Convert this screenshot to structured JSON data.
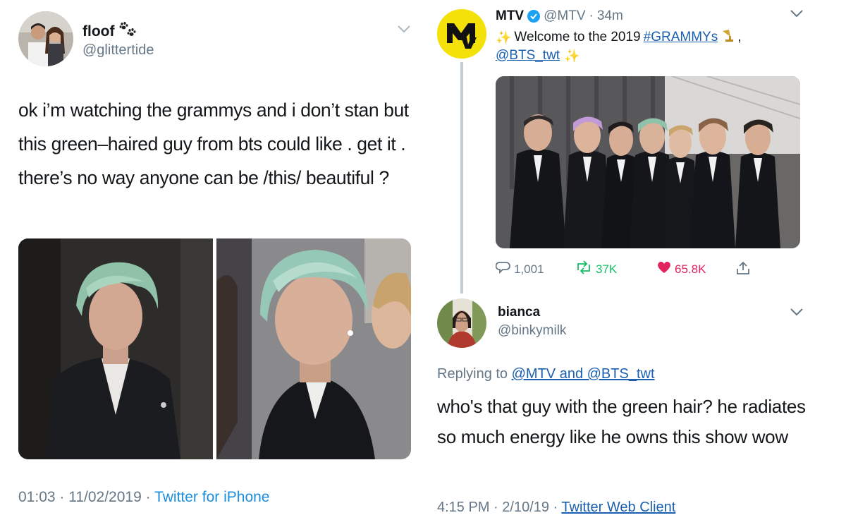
{
  "left_tweet": {
    "display_name": "floof",
    "name_emoji": "paw-prints-icon",
    "handle": "@glittertide",
    "text": "ok i’m watching the grammys and i don’t stan but this green–haired guy from bts could like . get it . there’s no way anyone can be /this/ beautiful ?",
    "time": "01:03",
    "date": "11/02/2019",
    "source": "Twitter for iPhone"
  },
  "mtv_tweet": {
    "display_name": "MTV",
    "handle": "@MTV",
    "age": "34m",
    "text_prefix": "Welcome to the 2019",
    "hashtag": "#GRAMMYs",
    "comma": ",",
    "mention": "@BTS_twt",
    "replies": "1,001",
    "retweets": "37K",
    "likes": "65.8K",
    "colors": {
      "retweet": "#17bf63",
      "like": "#e0245e",
      "logo_bg": "#f5e10a"
    }
  },
  "reply_tweet": {
    "display_name": "bianca",
    "handle": "@binkymilk",
    "replying_label": "Replying to",
    "replying_to": "@MTV and @BTS_twt",
    "text": "who's that guy with the green hair? he radiates so much energy like he owns this show wow",
    "time": "4:15 PM",
    "date": "2/10/19",
    "source": "Twitter Web Client"
  },
  "separator": " · "
}
